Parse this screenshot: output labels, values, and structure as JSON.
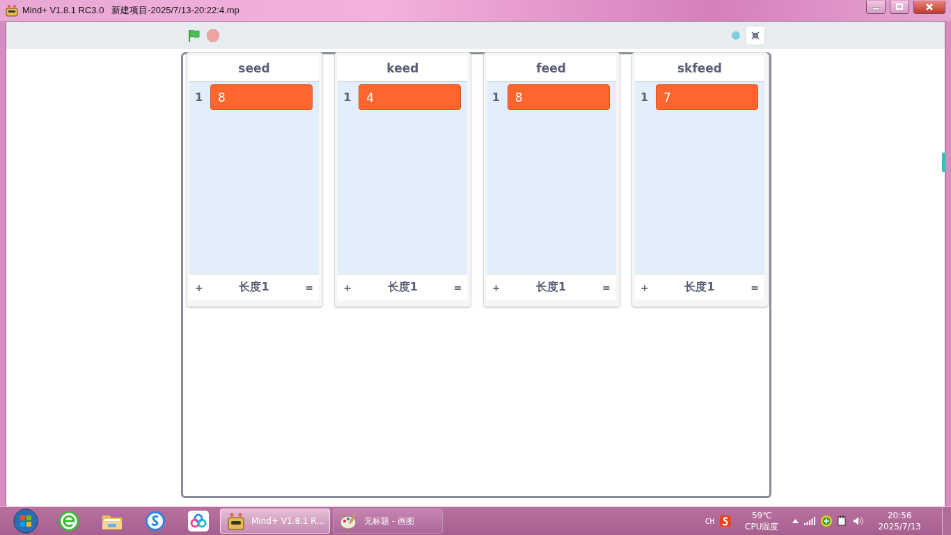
{
  "window": {
    "title": "Mind+ V1.8.1 RC3.0   新建项目-2025/7/13-20:22:4.mp"
  },
  "lists": [
    {
      "name": "seed",
      "items": [
        {
          "index": "1",
          "value": "8"
        }
      ],
      "add": "+",
      "length": "长度1",
      "resize": "="
    },
    {
      "name": "keed",
      "items": [
        {
          "index": "1",
          "value": "4"
        }
      ],
      "add": "+",
      "length": "长度1",
      "resize": "="
    },
    {
      "name": "feed",
      "items": [
        {
          "index": "1",
          "value": "8"
        }
      ],
      "add": "+",
      "length": "长度1",
      "resize": "="
    },
    {
      "name": "skfeed",
      "items": [
        {
          "index": "1",
          "value": "7"
        }
      ],
      "add": "+",
      "length": "长度1",
      "resize": "="
    }
  ],
  "taskbar": {
    "tasks": [
      {
        "kind": "mindplus",
        "label": "Mind+ V1.8.1 R...",
        "selected": true
      },
      {
        "kind": "paint",
        "label": "无标题 - 画图",
        "selected": false
      }
    ],
    "tray": {
      "ime": "CH",
      "temperature": "59℃",
      "temperature_label": "CPU温度",
      "time": "20:56",
      "date": "2025/7/13"
    }
  }
}
